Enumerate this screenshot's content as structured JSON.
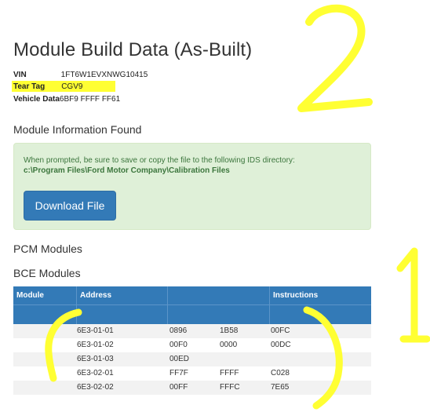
{
  "page": {
    "title": "Module Build Data (As-Built)",
    "vin_label": "VIN",
    "vin_value": "1FT6W1EVXNWG10415",
    "tear_tag_label": "Tear Tag",
    "tear_tag_value": "CGV9",
    "vehicle_data_label": "Vehicle Data",
    "vehicle_data_value": "6BF9 FFFF FF61"
  },
  "found": {
    "heading": "Module Information Found",
    "notice_text": "When prompted, be sure to save or copy the file to the following IDS directory:",
    "notice_path": "c:\\Program Files\\Ford Motor Company\\Calibration Files",
    "download_label": "Download File"
  },
  "sections": {
    "pcm_heading": "PCM Modules",
    "bce_heading": "BCE Modules"
  },
  "table": {
    "headers": [
      "Module",
      "Address",
      "",
      "Instructions"
    ],
    "rows": [
      [
        "",
        "6E3-01-01",
        "0896",
        "1B58",
        "00FC"
      ],
      [
        "",
        "6E3-01-02",
        "00F0",
        "0000",
        "00DC"
      ],
      [
        "",
        "6E3-01-03",
        "00ED",
        "",
        ""
      ],
      [
        "",
        "6E3-02-01",
        "FF7F",
        "FFFF",
        "C028"
      ],
      [
        "",
        "6E3-02-02",
        "00FF",
        "FFFC",
        "7E65"
      ]
    ]
  },
  "annotations": {
    "number_two": "2",
    "number_one": "1",
    "color": "#ffff33"
  }
}
